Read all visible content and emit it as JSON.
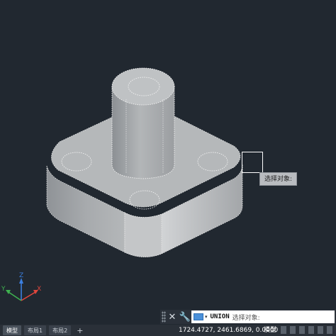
{
  "viewport": {
    "model": "3d-flange-with-cylinder-boss",
    "background": "#212830",
    "ucs": {
      "x_label": "X",
      "y_label": "Y",
      "z_label": "Z",
      "x_color": "#e0463c",
      "y_color": "#3fb24f",
      "z_color": "#3b7fe0"
    }
  },
  "tooltip": {
    "text": "选择对象:"
  },
  "command": {
    "close_icon": "close-icon",
    "customize_icon": "wrench-icon",
    "name": "UNION",
    "prompt": "选择对象:"
  },
  "status": {
    "tabs": [
      {
        "label": "模型",
        "active": true
      },
      {
        "label": "布局1",
        "active": false
      },
      {
        "label": "布局2",
        "active": false
      }
    ],
    "add_tab": "+",
    "coordinates": "1724.4727, 2461.6869, 0.0000",
    "space": "模型"
  }
}
